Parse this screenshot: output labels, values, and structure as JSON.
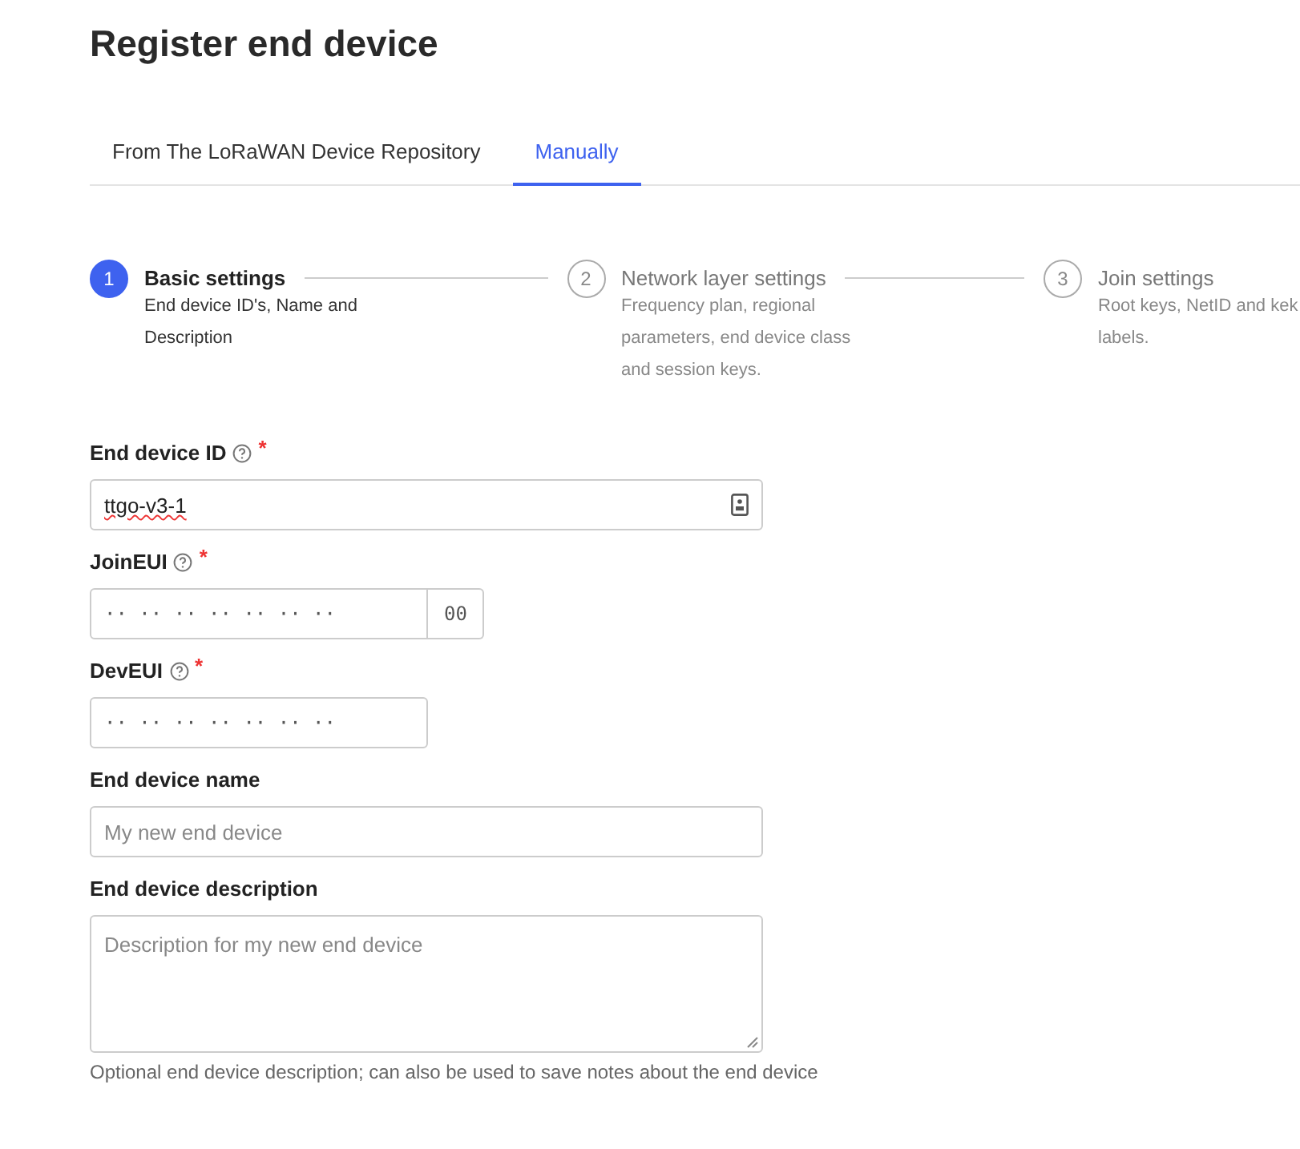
{
  "page": {
    "title": "Register end device"
  },
  "tabs": [
    {
      "label": "From The LoRaWAN Device Repository",
      "selected": false
    },
    {
      "label": "Manually",
      "selected": true
    }
  ],
  "steps": [
    {
      "number": "1",
      "title": "Basic settings",
      "description": "End device ID's, Name and Description",
      "active": true
    },
    {
      "number": "2",
      "title": "Network layer settings",
      "description": "Frequency plan, regional parameters, end device class and session keys.",
      "active": false
    },
    {
      "number": "3",
      "title": "Join settings",
      "description": "Root keys, NetID and kek labels.",
      "active": false
    }
  ],
  "fields": [
    {
      "kind": "text",
      "label": "End device ID",
      "help": true,
      "required_mark": "*",
      "value": "ttgo-v3-1",
      "spellcheck_error": true,
      "trailing_icon": true
    },
    {
      "kind": "eui",
      "label": "JoinEUI",
      "help": true,
      "required_mark": "*",
      "placeholder": "·· ·· ·· ·· ·· ·· ··",
      "button": "00"
    },
    {
      "kind": "eui",
      "label": "DevEUI",
      "help": true,
      "required_mark": "*",
      "placeholder": "·· ·· ·· ·· ·· ·· ··"
    },
    {
      "kind": "text",
      "label": "End device name",
      "placeholder": "My new end device"
    },
    {
      "kind": "textarea",
      "label": "End device description",
      "placeholder": "Description for my new end device",
      "hint": "Optional end device description; can also be used to save notes about the end device"
    }
  ]
}
